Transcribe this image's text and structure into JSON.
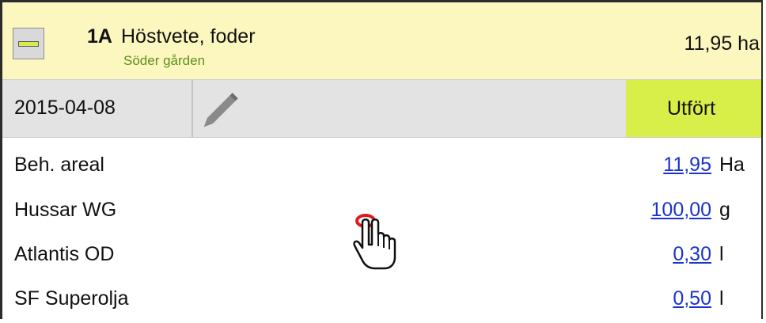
{
  "field": {
    "code": "1A",
    "name": "Höstvete, foder",
    "location": "Söder gården",
    "area": "11,95 ha"
  },
  "action": {
    "date": "2015-04-08",
    "status_label": "Utfört"
  },
  "inputs": [
    {
      "label": "Beh. areal",
      "value": "11,95",
      "unit": "Ha"
    },
    {
      "label": "Hussar WG",
      "value": "100,00",
      "unit": "g"
    },
    {
      "label": "Atlantis OD",
      "value": "0,30",
      "unit": "l"
    },
    {
      "label": "SF Superolja",
      "value": "0,50",
      "unit": "l"
    }
  ],
  "colors": {
    "header_background": "#fbf7bf",
    "location_text": "#5f8f1a",
    "action_row_background": "#e3e3e3",
    "status_button": "#d9ef49",
    "link_value": "#1a33cc",
    "click_marker": "#e01a1a"
  },
  "icons": {
    "collapse": "collapse-minus-icon",
    "edit": "pencil-icon",
    "pointer": "hand-pointer-icon"
  }
}
